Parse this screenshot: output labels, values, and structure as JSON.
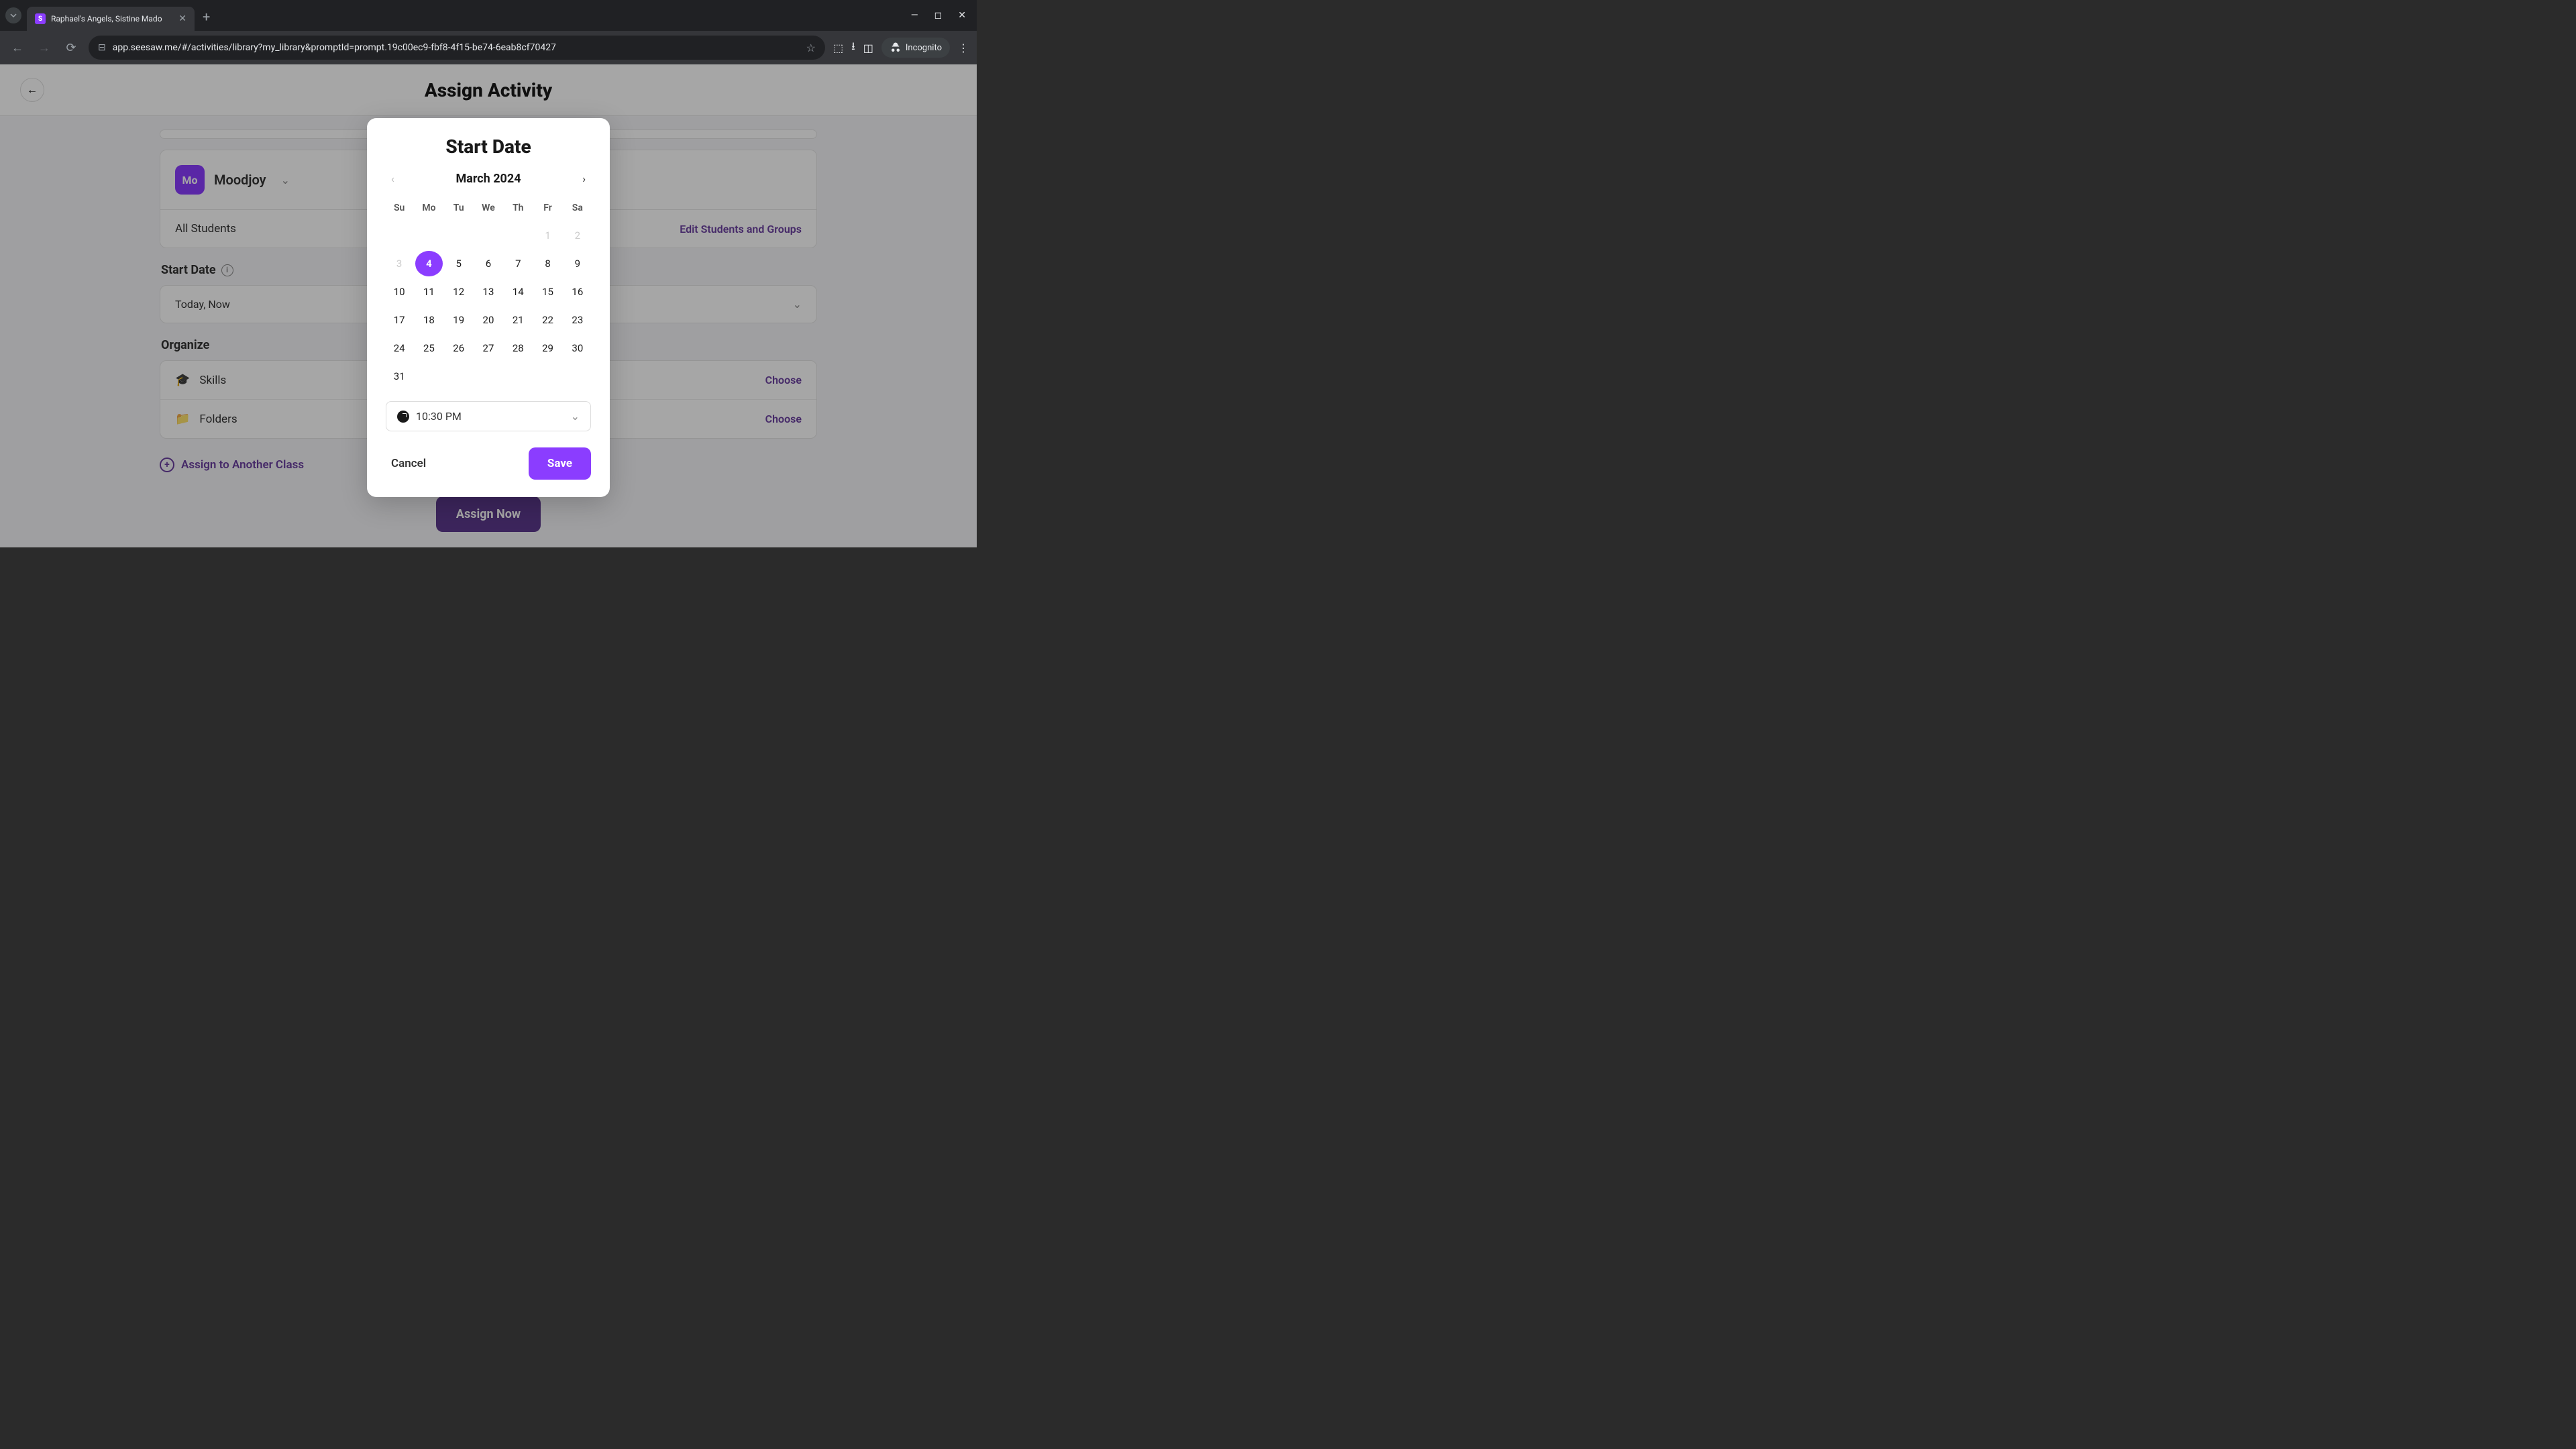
{
  "browser": {
    "tab_title": "Raphael's Angels, Sistine Mado",
    "tab_favicon": "S",
    "url": "app.seesaw.me/#/activities/library?my_library&promptId=prompt.19c00ec9-fbf8-4f15-be74-6eab8cf70427",
    "incognito_label": "Incognito"
  },
  "page": {
    "title": "Assign Activity",
    "class_badge": "Mo",
    "class_name": "Moodjoy",
    "students_label": "All Students",
    "edit_students": "Edit Students and Groups",
    "start_date_label": "Start Date",
    "start_date_value": "Today, Now",
    "organize_label": "Organize",
    "skills_label": "Skills",
    "folders_label": "Folders",
    "choose_label": "Choose",
    "assign_another": "Assign to Another Class",
    "assign_now": "Assign Now"
  },
  "modal": {
    "title": "Start Date",
    "month": "March 2024",
    "weekdays": [
      "Su",
      "Mo",
      "Tu",
      "We",
      "Th",
      "Fr",
      "Sa"
    ],
    "weeks": [
      [
        {
          "n": "",
          "t": "empty"
        },
        {
          "n": "",
          "t": "empty"
        },
        {
          "n": "",
          "t": "empty"
        },
        {
          "n": "",
          "t": "empty"
        },
        {
          "n": "",
          "t": "empty"
        },
        {
          "n": "1",
          "t": "disabled"
        },
        {
          "n": "2",
          "t": "disabled"
        }
      ],
      [
        {
          "n": "3",
          "t": "disabled"
        },
        {
          "n": "4",
          "t": "selected"
        },
        {
          "n": "5",
          "t": "normal"
        },
        {
          "n": "6",
          "t": "normal"
        },
        {
          "n": "7",
          "t": "normal"
        },
        {
          "n": "8",
          "t": "normal"
        },
        {
          "n": "9",
          "t": "normal"
        }
      ],
      [
        {
          "n": "10",
          "t": "normal"
        },
        {
          "n": "11",
          "t": "normal"
        },
        {
          "n": "12",
          "t": "normal"
        },
        {
          "n": "13",
          "t": "normal"
        },
        {
          "n": "14",
          "t": "normal"
        },
        {
          "n": "15",
          "t": "normal"
        },
        {
          "n": "16",
          "t": "normal"
        }
      ],
      [
        {
          "n": "17",
          "t": "normal"
        },
        {
          "n": "18",
          "t": "normal"
        },
        {
          "n": "19",
          "t": "normal"
        },
        {
          "n": "20",
          "t": "normal"
        },
        {
          "n": "21",
          "t": "normal"
        },
        {
          "n": "22",
          "t": "normal"
        },
        {
          "n": "23",
          "t": "normal"
        }
      ],
      [
        {
          "n": "24",
          "t": "normal"
        },
        {
          "n": "25",
          "t": "normal"
        },
        {
          "n": "26",
          "t": "normal"
        },
        {
          "n": "27",
          "t": "normal"
        },
        {
          "n": "28",
          "t": "normal"
        },
        {
          "n": "29",
          "t": "normal"
        },
        {
          "n": "30",
          "t": "normal"
        }
      ],
      [
        {
          "n": "31",
          "t": "normal"
        },
        {
          "n": "",
          "t": "empty"
        },
        {
          "n": "",
          "t": "empty"
        },
        {
          "n": "",
          "t": "empty"
        },
        {
          "n": "",
          "t": "empty"
        },
        {
          "n": "",
          "t": "empty"
        },
        {
          "n": "",
          "t": "empty"
        }
      ]
    ],
    "time": "10:30 PM",
    "cancel": "Cancel",
    "save": "Save"
  }
}
